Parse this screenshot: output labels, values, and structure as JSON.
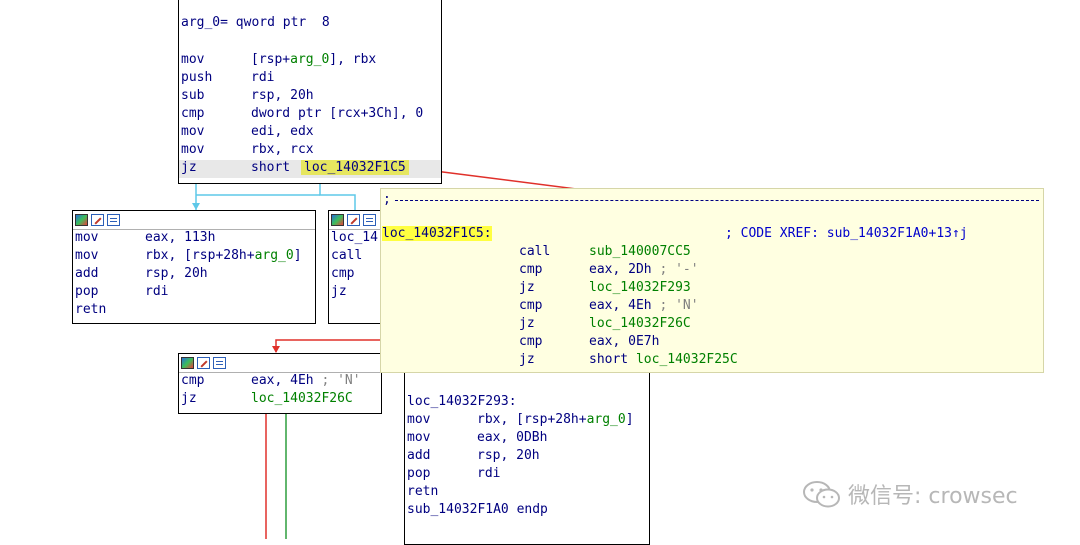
{
  "blocks": {
    "top": {
      "header_line": "arg_0= qword ptr  8",
      "lines": [
        {
          "mn": "mov",
          "op": "[rsp+arg_0], rbx"
        },
        {
          "mn": "push",
          "op": "rdi"
        },
        {
          "mn": "sub",
          "op": "rsp, 20h"
        },
        {
          "mn": "cmp",
          "op": "dword ptr [rcx+3Ch], 0"
        },
        {
          "mn": "mov",
          "op": "edi, edx"
        },
        {
          "mn": "mov",
          "op": "rbx, rcx"
        }
      ],
      "jz_mn": "jz",
      "jz_short": "short",
      "jz_target": "loc_14032F1C5"
    },
    "left": {
      "lines": [
        {
          "mn": "mov",
          "op": "eax, 113h"
        },
        {
          "mn": "mov",
          "op": "rbx, [rsp+28h+arg_0]"
        },
        {
          "mn": "add",
          "op": "rsp, 20h"
        },
        {
          "mn": "pop",
          "op": "rdi"
        },
        {
          "mn": "retn",
          "op": ""
        }
      ]
    },
    "mid_partial": {
      "lines": [
        {
          "mn": "loc_14",
          "op": ""
        },
        {
          "mn": "call",
          "op": ""
        },
        {
          "mn": "cmp",
          "op": ""
        },
        {
          "mn": "jz",
          "op": ""
        }
      ]
    },
    "cmp_block": {
      "lines": [
        {
          "mn": "cmp",
          "op": "eax, 4Eh ; 'N'"
        },
        {
          "mn": "jz",
          "op": "loc_14032F26C"
        }
      ]
    },
    "exit_block": {
      "label": "loc_14032F293:",
      "lines": [
        {
          "mn": "mov",
          "op": "rbx, [rsp+28h+arg_0]"
        },
        {
          "mn": "mov",
          "op": "eax, 0DBh"
        },
        {
          "mn": "add",
          "op": "rsp, 20h"
        },
        {
          "mn": "pop",
          "op": "rdi"
        },
        {
          "mn": "retn",
          "op": ""
        }
      ],
      "endp": "sub_14032F1A0 endp"
    }
  },
  "tooltip": {
    "separator": ";",
    "label": "loc_14032F1C5:",
    "xref": "; CODE XREF: sub_14032F1A0+13↑j",
    "lines": [
      {
        "mn": "call",
        "op": "sub_140007CC5"
      },
      {
        "mn": "cmp",
        "op": "eax, 2Dh ; '-'"
      },
      {
        "mn": "jz",
        "op": "loc_14032F293"
      },
      {
        "mn": "cmp",
        "op": "eax, 4Eh ; 'N'"
      },
      {
        "mn": "jz",
        "op": "loc_14032F26C"
      },
      {
        "mn": "cmp",
        "op": "eax, 0E7h"
      },
      {
        "mn": "jz",
        "op": "short loc_14032F25C"
      }
    ]
  },
  "watermark": {
    "text": "微信号: crowsec",
    "icon": "wechat-icon"
  },
  "colors": {
    "true_edge": "#2e9e3e",
    "false_edge": "#e0302a",
    "uncond_edge": "#5ec8e8",
    "xref_arrow": "#e0302a",
    "tooltip_bg": "#ffffe1",
    "highlight": "#ffff40"
  }
}
